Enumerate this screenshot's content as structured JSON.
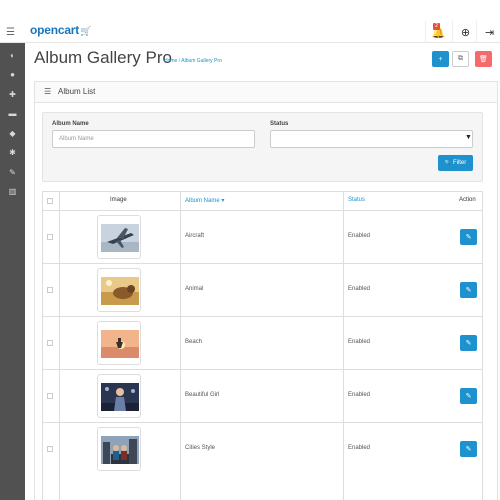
{
  "header": {
    "logo_text": "opencart",
    "logo_cart_glyph": "🛒",
    "menu_icon": "☰",
    "bell_icon": "🔔",
    "bell_badge": "2",
    "help_icon": "⊕",
    "logout_icon": "⇥"
  },
  "sidebar": {
    "icons": [
      "◐",
      "●",
      "✚",
      "▬",
      "◆",
      "✱",
      "✎",
      "▥"
    ],
    "icon_names": [
      "dashboard",
      "catalog",
      "extensions",
      "sales",
      "marketing",
      "system",
      "tools",
      "reports"
    ]
  },
  "page": {
    "title": "Album Gallery Pro",
    "breadcrumb": {
      "home": "Home",
      "separator": "/",
      "current": "Album Gallery Pro"
    },
    "buttons": {
      "add_glyph": "+",
      "copy_glyph": "⧉",
      "delete_glyph": "🗑"
    },
    "colors": {
      "primary": "#1e91cf",
      "danger": "#f56b6b"
    }
  },
  "panel": {
    "title": "Album List",
    "list_icon": "☰"
  },
  "filter": {
    "album_name_label": "Album Name",
    "album_name_placeholder": "Album Name",
    "status_label": "Status",
    "status_value": "",
    "select_arrow": "▼",
    "button_label": "Filter",
    "button_icon": "🔍"
  },
  "table": {
    "headers": {
      "image": "Image",
      "album_name": "Album Name",
      "sort_indicator": "▾",
      "status": "Status",
      "action": "Action"
    },
    "edit_glyph": "✎",
    "rows": [
      {
        "name": "Aircraft",
        "status": "Enabled"
      },
      {
        "name": "Animal",
        "status": "Enabled"
      },
      {
        "name": "Beach",
        "status": "Enabled"
      },
      {
        "name": "Beautiful Girl",
        "status": "Enabled"
      },
      {
        "name": "Cities Style",
        "status": "Enabled"
      }
    ]
  }
}
